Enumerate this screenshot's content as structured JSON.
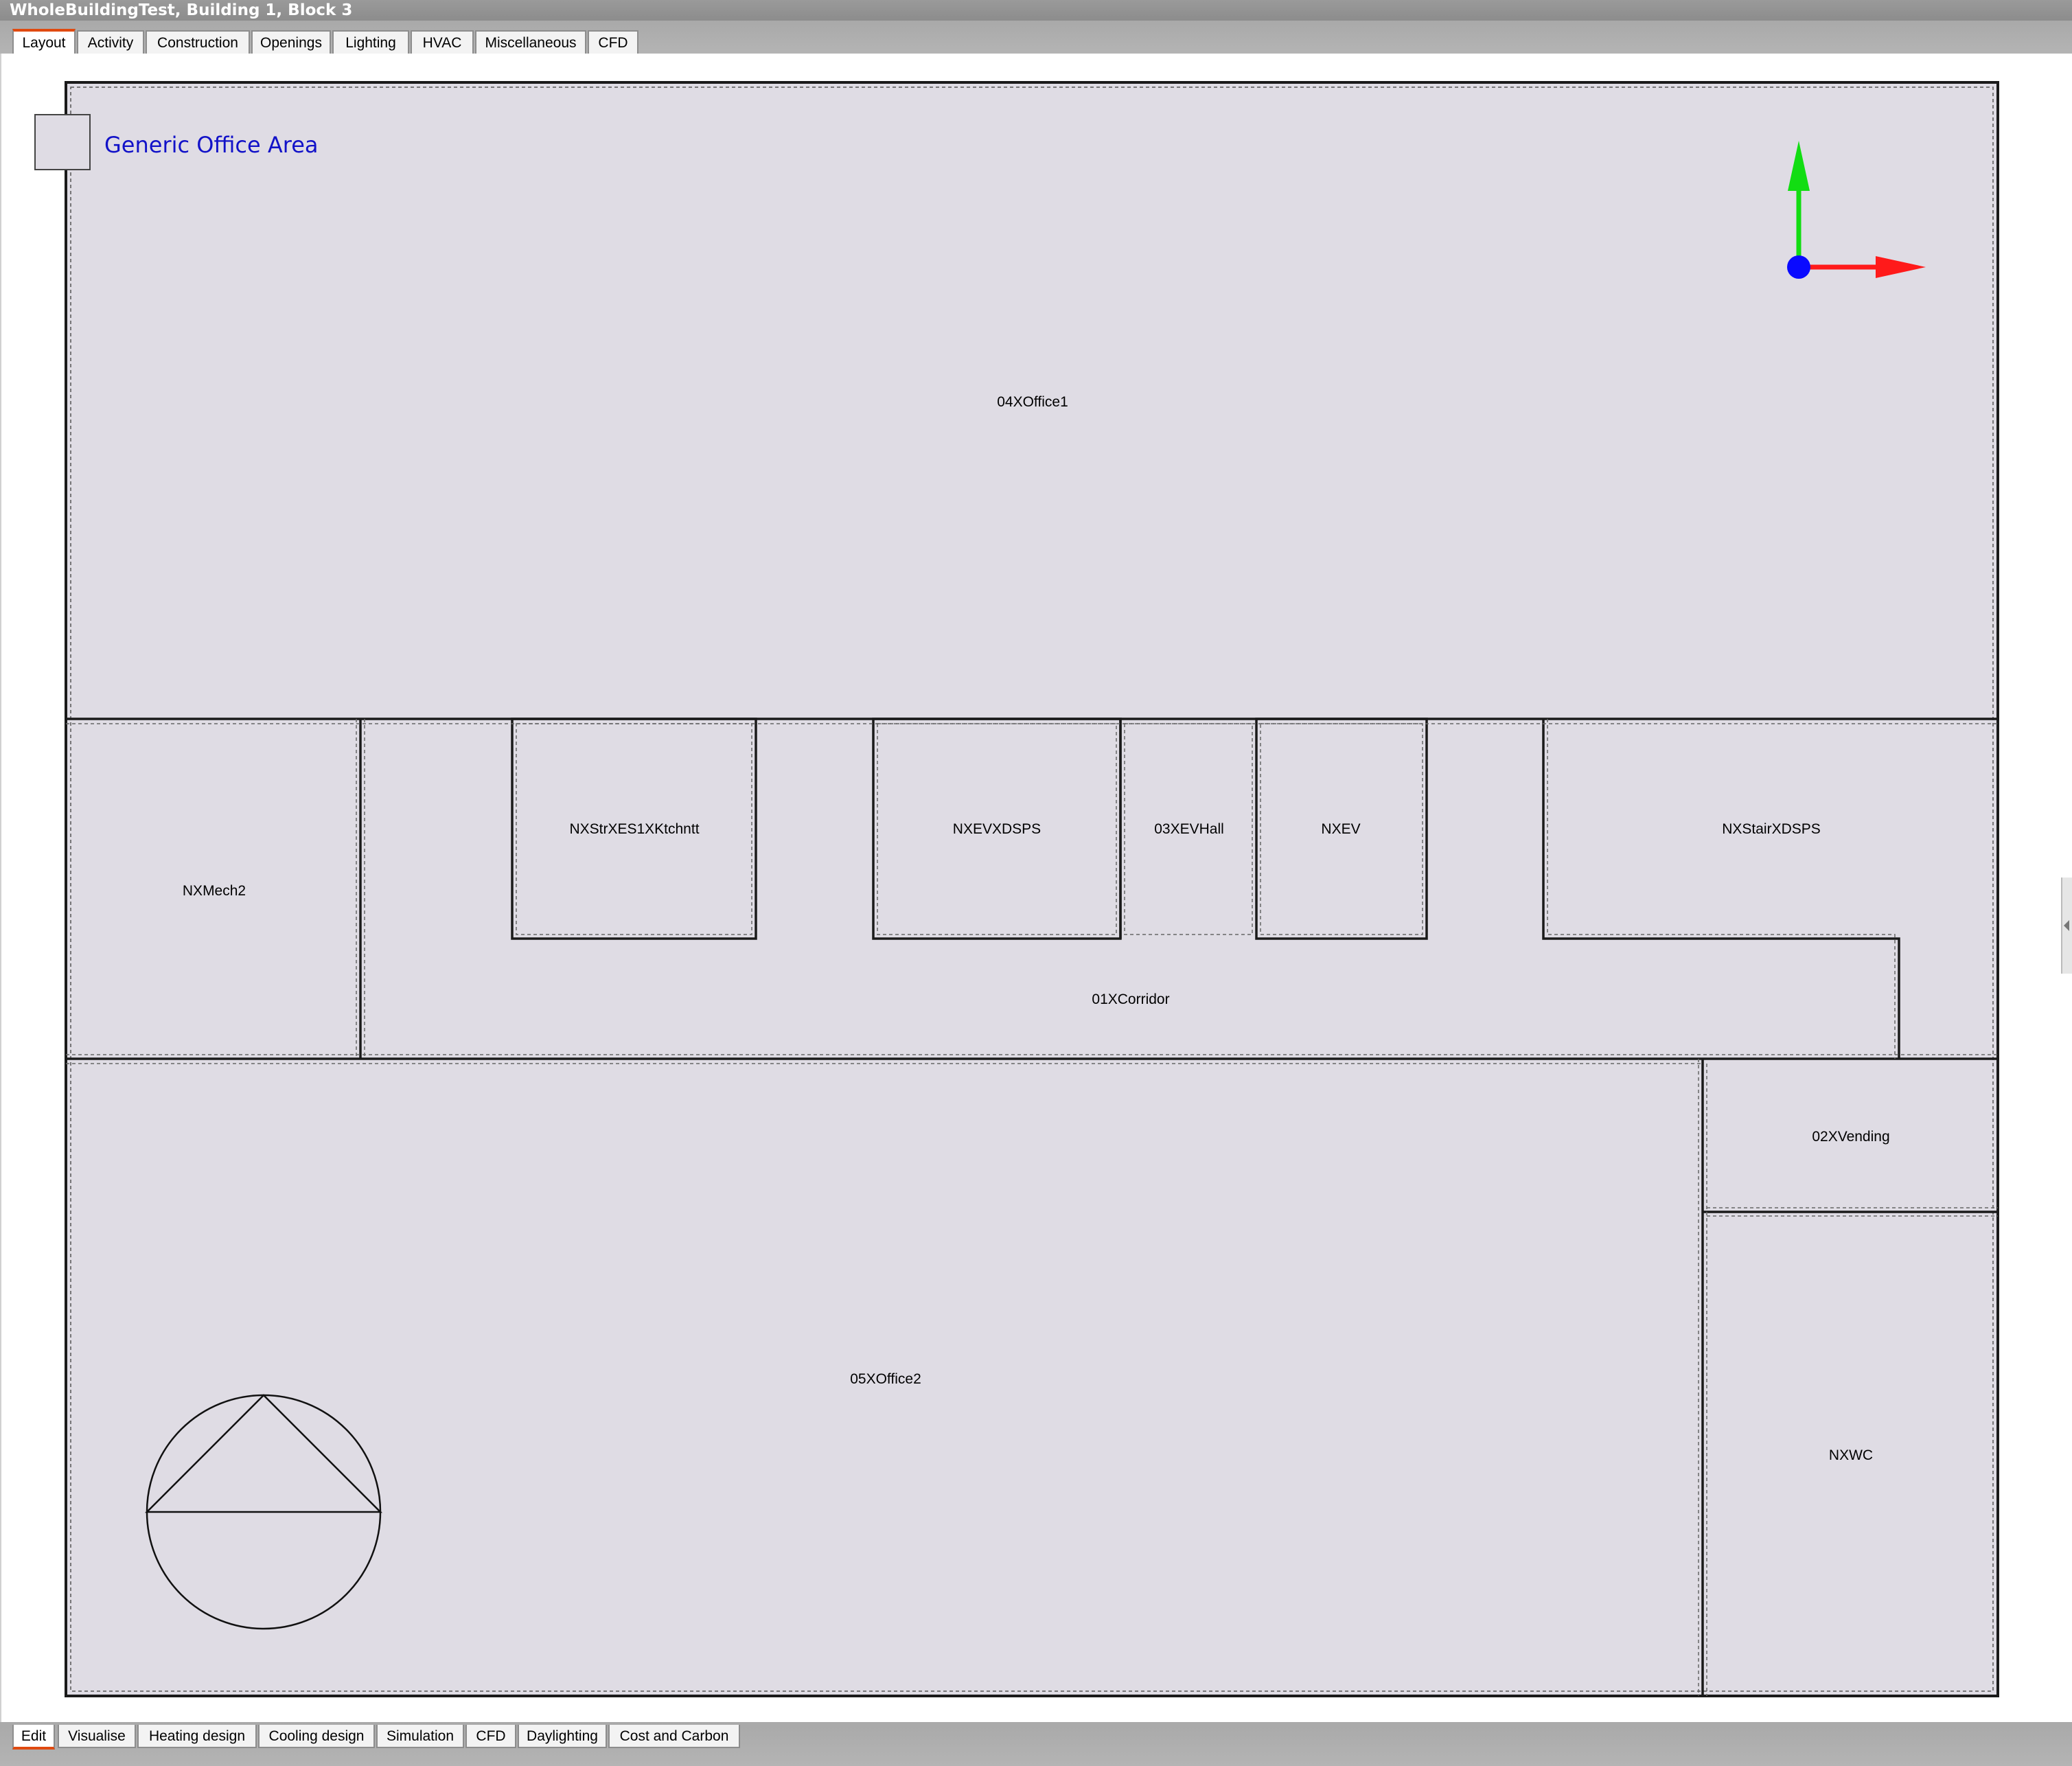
{
  "window": {
    "title": "WholeBuildingTest, Building 1, Block 3"
  },
  "top_tabs": [
    {
      "label": "Layout",
      "active": true
    },
    {
      "label": "Activity",
      "active": false
    },
    {
      "label": "Construction",
      "active": false
    },
    {
      "label": "Openings",
      "active": false
    },
    {
      "label": "Lighting",
      "active": false
    },
    {
      "label": "HVAC",
      "active": false
    },
    {
      "label": "Miscellaneous",
      "active": false
    },
    {
      "label": "CFD",
      "active": false
    }
  ],
  "bottom_tabs": [
    {
      "label": "Edit",
      "active": true
    },
    {
      "label": "Visualise",
      "active": false
    },
    {
      "label": "Heating design",
      "active": false
    },
    {
      "label": "Cooling design",
      "active": false
    },
    {
      "label": "Simulation",
      "active": false
    },
    {
      "label": "CFD",
      "active": false
    },
    {
      "label": "Daylighting",
      "active": false
    },
    {
      "label": "Cost and Carbon",
      "active": false
    }
  ],
  "legend": {
    "label": "Generic Office Area",
    "swatch_color": "#dfdce4"
  },
  "colors": {
    "zone_fill": "#dfdce4",
    "zone_outline": "#1a1a1a",
    "axis_x": "#ff1a1a",
    "axis_y": "#12dd12",
    "axis_origin": "#0a0aff",
    "legend_text": "#1212c8",
    "active_tab_accent": "#e04a10"
  },
  "zones": [
    {
      "name": "04XOffice1"
    },
    {
      "name": "NXMech2"
    },
    {
      "name": "NXStrXES1XKtchntt"
    },
    {
      "name": "NXEVXDSPS"
    },
    {
      "name": "03XEVHall"
    },
    {
      "name": "NXEV"
    },
    {
      "name": "NXStairXDSPS"
    },
    {
      "name": "01XCorridor"
    },
    {
      "name": "02XVending"
    },
    {
      "name": "05XOffice2"
    },
    {
      "name": "NXWC"
    }
  ],
  "icons": {
    "axes": "xy-axes-icon",
    "site_marker": "site-origin-icon"
  }
}
